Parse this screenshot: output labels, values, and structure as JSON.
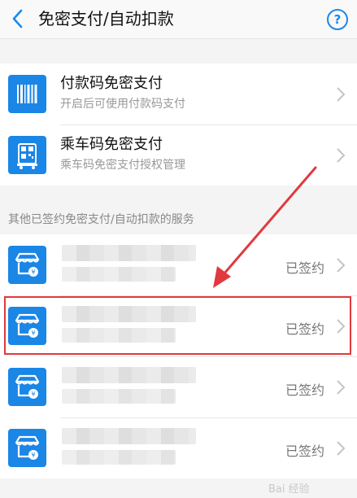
{
  "header": {
    "title": "免密支付/自动扣款",
    "help_label": "?"
  },
  "top_items": [
    {
      "title": "付款码免密支付",
      "subtitle": "开启后可使用付款码支付",
      "icon": "barcode-icon"
    },
    {
      "title": "乘车码免密支付",
      "subtitle": "乘车码免密支付授权管理",
      "icon": "qr-code-icon"
    }
  ],
  "section_label": "其他已签约免密支付/自动扣款的服务",
  "services": [
    {
      "status": "已签约",
      "icon": "store-icon"
    },
    {
      "status": "已签约",
      "icon": "store-icon"
    },
    {
      "status": "已签约",
      "icon": "store-icon"
    },
    {
      "status": "已签约",
      "icon": "store-icon"
    }
  ],
  "watermark": "Bai 经验",
  "colors": {
    "accent": "#1a86e6",
    "highlight": "#e03a3e"
  }
}
